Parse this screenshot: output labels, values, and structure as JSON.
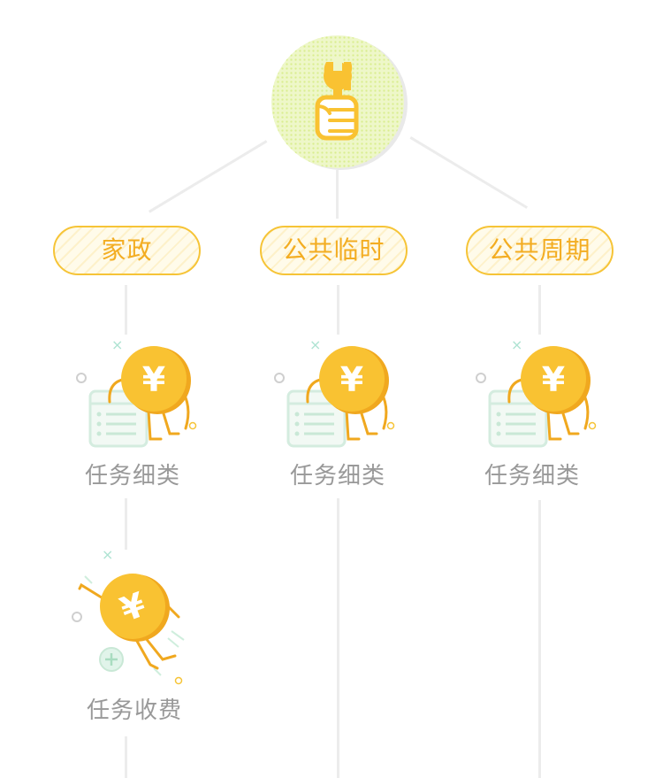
{
  "root": {
    "icon": "wrench-fist-icon"
  },
  "categories": [
    {
      "label": "家政"
    },
    {
      "label": "公共临时"
    },
    {
      "label": "公共周期"
    }
  ],
  "subtasks": [
    {
      "label": "任务细类",
      "icon": "coin-calendar-icon"
    },
    {
      "label": "任务细类",
      "icon": "coin-calendar-icon"
    },
    {
      "label": "任务细类",
      "icon": "coin-calendar-icon"
    }
  ],
  "fee": {
    "label": "任务收费",
    "icon": "coin-add-icon"
  },
  "colors": {
    "accent": "#f6c437",
    "accent_text": "#f3ad22",
    "coin": "#f9c232",
    "coin_shadow": "#f0a81f",
    "green": "#cfeedd",
    "line": "#ececec",
    "label": "#999999"
  }
}
